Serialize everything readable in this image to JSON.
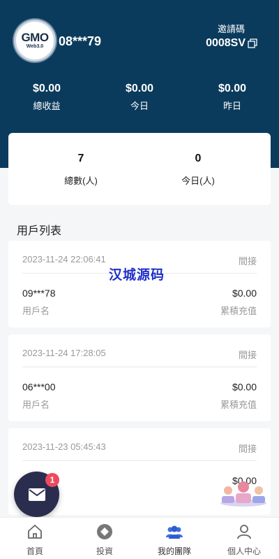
{
  "header": {
    "logo_text": "GMO",
    "logo_sub": "Web3.0",
    "account": "08***79",
    "invite_label": "邀請碼",
    "invite_code": "0008SV"
  },
  "stats": [
    {
      "value": "$0.00",
      "label": "總收益"
    },
    {
      "value": "$0.00",
      "label": "今日"
    },
    {
      "value": "$0.00",
      "label": "昨日"
    }
  ],
  "summary": [
    {
      "value": "7",
      "label": "總數(人)"
    },
    {
      "value": "0",
      "label": "今日(人)"
    }
  ],
  "list_title": "用戶列表",
  "records": [
    {
      "date": "2023-11-24 22:06:41",
      "type": "間接",
      "user": "09***78",
      "amount": "$0.00",
      "user_label": "用戶名",
      "amount_label": "累積充值"
    },
    {
      "date": "2023-11-24 17:28:05",
      "type": "間接",
      "user": "06***00",
      "amount": "$0.00",
      "user_label": "用戶名",
      "amount_label": "累積充值"
    },
    {
      "date": "2023-11-23 05:45:43",
      "type": "間接",
      "user": "",
      "amount": "$0.00",
      "user_label": "",
      "amount_label": ""
    }
  ],
  "watermark": "汉城源码",
  "message_badge": "1",
  "tabs": [
    {
      "label": "首頁",
      "icon": "home-icon"
    },
    {
      "label": "投資",
      "icon": "invest-icon"
    },
    {
      "label": "我的團隊",
      "icon": "team-icon"
    },
    {
      "label": "個人中心",
      "icon": "profile-icon"
    }
  ],
  "colors": {
    "header_bg": "#0b3b5c",
    "active_tab": "#3d6fe0",
    "badge": "#ee4a5e",
    "fab": "#2b2d4f"
  }
}
